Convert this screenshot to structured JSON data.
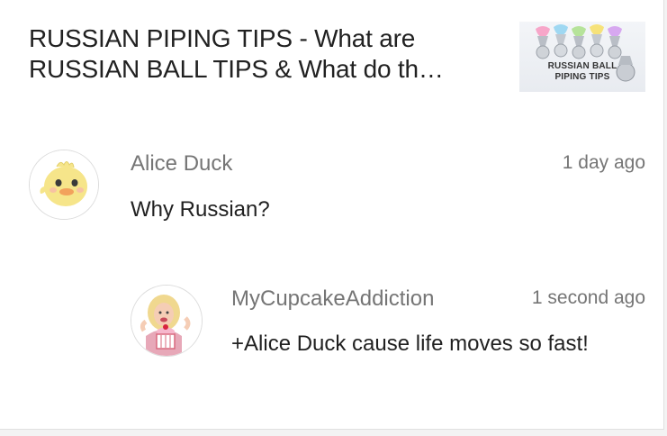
{
  "video": {
    "title": "RUSSIAN PIPING TIPS - What are RUSSIAN BALL TIPS & What do th…",
    "thumbnail_caption_line1": "RUSSIAN BALL",
    "thumbnail_caption_line2": "PIPING TIPS"
  },
  "comments": [
    {
      "author": "Alice Duck",
      "time": "1 day ago",
      "text": "Why Russian?",
      "avatar_icon": "duck-avatar-icon"
    },
    {
      "author": "MyCupcakeAddiction",
      "time": "1 second ago",
      "text": "+Alice Duck cause life moves so fast!",
      "avatar_icon": "cupcake-avatar-icon",
      "is_reply": true
    }
  ],
  "colors": {
    "title": "#212121",
    "meta": "#757575",
    "background": "#ffffff"
  }
}
